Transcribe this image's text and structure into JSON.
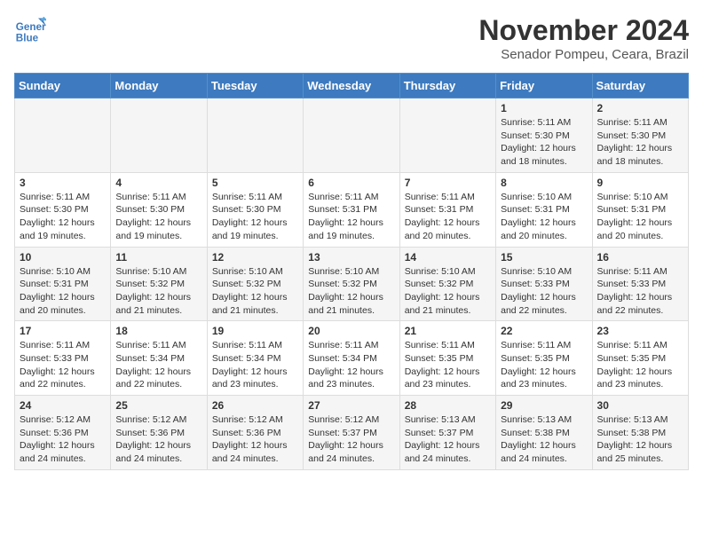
{
  "header": {
    "logo_line1": "General",
    "logo_line2": "Blue",
    "month": "November 2024",
    "location": "Senador Pompeu, Ceara, Brazil"
  },
  "weekdays": [
    "Sunday",
    "Monday",
    "Tuesday",
    "Wednesday",
    "Thursday",
    "Friday",
    "Saturday"
  ],
  "weeks": [
    [
      {
        "day": "",
        "info": ""
      },
      {
        "day": "",
        "info": ""
      },
      {
        "day": "",
        "info": ""
      },
      {
        "day": "",
        "info": ""
      },
      {
        "day": "",
        "info": ""
      },
      {
        "day": "1",
        "info": "Sunrise: 5:11 AM\nSunset: 5:30 PM\nDaylight: 12 hours and 18 minutes."
      },
      {
        "day": "2",
        "info": "Sunrise: 5:11 AM\nSunset: 5:30 PM\nDaylight: 12 hours and 18 minutes."
      }
    ],
    [
      {
        "day": "3",
        "info": "Sunrise: 5:11 AM\nSunset: 5:30 PM\nDaylight: 12 hours and 19 minutes."
      },
      {
        "day": "4",
        "info": "Sunrise: 5:11 AM\nSunset: 5:30 PM\nDaylight: 12 hours and 19 minutes."
      },
      {
        "day": "5",
        "info": "Sunrise: 5:11 AM\nSunset: 5:30 PM\nDaylight: 12 hours and 19 minutes."
      },
      {
        "day": "6",
        "info": "Sunrise: 5:11 AM\nSunset: 5:31 PM\nDaylight: 12 hours and 19 minutes."
      },
      {
        "day": "7",
        "info": "Sunrise: 5:11 AM\nSunset: 5:31 PM\nDaylight: 12 hours and 20 minutes."
      },
      {
        "day": "8",
        "info": "Sunrise: 5:10 AM\nSunset: 5:31 PM\nDaylight: 12 hours and 20 minutes."
      },
      {
        "day": "9",
        "info": "Sunrise: 5:10 AM\nSunset: 5:31 PM\nDaylight: 12 hours and 20 minutes."
      }
    ],
    [
      {
        "day": "10",
        "info": "Sunrise: 5:10 AM\nSunset: 5:31 PM\nDaylight: 12 hours and 20 minutes."
      },
      {
        "day": "11",
        "info": "Sunrise: 5:10 AM\nSunset: 5:32 PM\nDaylight: 12 hours and 21 minutes."
      },
      {
        "day": "12",
        "info": "Sunrise: 5:10 AM\nSunset: 5:32 PM\nDaylight: 12 hours and 21 minutes."
      },
      {
        "day": "13",
        "info": "Sunrise: 5:10 AM\nSunset: 5:32 PM\nDaylight: 12 hours and 21 minutes."
      },
      {
        "day": "14",
        "info": "Sunrise: 5:10 AM\nSunset: 5:32 PM\nDaylight: 12 hours and 21 minutes."
      },
      {
        "day": "15",
        "info": "Sunrise: 5:10 AM\nSunset: 5:33 PM\nDaylight: 12 hours and 22 minutes."
      },
      {
        "day": "16",
        "info": "Sunrise: 5:11 AM\nSunset: 5:33 PM\nDaylight: 12 hours and 22 minutes."
      }
    ],
    [
      {
        "day": "17",
        "info": "Sunrise: 5:11 AM\nSunset: 5:33 PM\nDaylight: 12 hours and 22 minutes."
      },
      {
        "day": "18",
        "info": "Sunrise: 5:11 AM\nSunset: 5:34 PM\nDaylight: 12 hours and 22 minutes."
      },
      {
        "day": "19",
        "info": "Sunrise: 5:11 AM\nSunset: 5:34 PM\nDaylight: 12 hours and 23 minutes."
      },
      {
        "day": "20",
        "info": "Sunrise: 5:11 AM\nSunset: 5:34 PM\nDaylight: 12 hours and 23 minutes."
      },
      {
        "day": "21",
        "info": "Sunrise: 5:11 AM\nSunset: 5:35 PM\nDaylight: 12 hours and 23 minutes."
      },
      {
        "day": "22",
        "info": "Sunrise: 5:11 AM\nSunset: 5:35 PM\nDaylight: 12 hours and 23 minutes."
      },
      {
        "day": "23",
        "info": "Sunrise: 5:11 AM\nSunset: 5:35 PM\nDaylight: 12 hours and 23 minutes."
      }
    ],
    [
      {
        "day": "24",
        "info": "Sunrise: 5:12 AM\nSunset: 5:36 PM\nDaylight: 12 hours and 24 minutes."
      },
      {
        "day": "25",
        "info": "Sunrise: 5:12 AM\nSunset: 5:36 PM\nDaylight: 12 hours and 24 minutes."
      },
      {
        "day": "26",
        "info": "Sunrise: 5:12 AM\nSunset: 5:36 PM\nDaylight: 12 hours and 24 minutes."
      },
      {
        "day": "27",
        "info": "Sunrise: 5:12 AM\nSunset: 5:37 PM\nDaylight: 12 hours and 24 minutes."
      },
      {
        "day": "28",
        "info": "Sunrise: 5:13 AM\nSunset: 5:37 PM\nDaylight: 12 hours and 24 minutes."
      },
      {
        "day": "29",
        "info": "Sunrise: 5:13 AM\nSunset: 5:38 PM\nDaylight: 12 hours and 24 minutes."
      },
      {
        "day": "30",
        "info": "Sunrise: 5:13 AM\nSunset: 5:38 PM\nDaylight: 12 hours and 25 minutes."
      }
    ]
  ]
}
